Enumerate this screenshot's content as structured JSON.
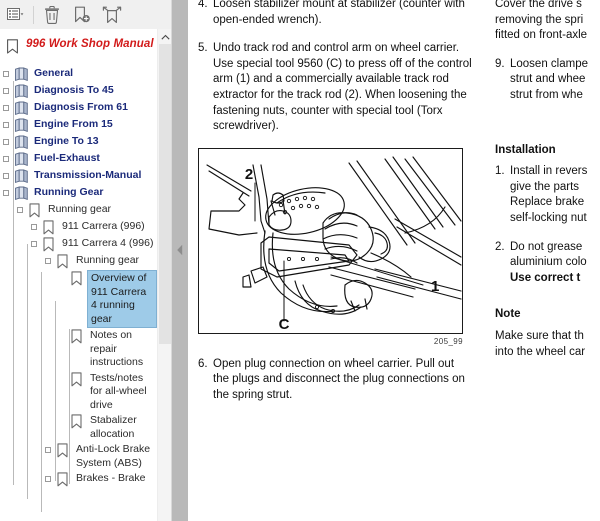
{
  "window": {
    "app_kind": "pdf-reader",
    "accent_red": "#d21b1b",
    "selection_blue": "#9ecbe8",
    "tree_text_blue": "#1b2a7a"
  },
  "bookmarks_toolbar": {
    "buttons": [
      {
        "name": "options-list-button",
        "icon": "list-options-icon",
        "label": "Options"
      },
      {
        "name": "delete-bookmark-button",
        "icon": "trash-icon",
        "label": "Delete"
      },
      {
        "name": "new-bookmark-button",
        "icon": "bookmark-plus-icon",
        "label": "New Bookmark"
      },
      {
        "name": "expand-bookmark-button",
        "icon": "bookmark-expand-icon",
        "label": "Expand Current Bookmark"
      }
    ]
  },
  "bookmarks": {
    "root_title": "996 Work Shop Manual",
    "root_icon": "bookmark-icon",
    "items": [
      {
        "label": "General",
        "level": 0,
        "icon": "book-icon",
        "expandable": true,
        "selected": false
      },
      {
        "label": "Diagnosis To 45",
        "level": 0,
        "icon": "book-icon",
        "expandable": true,
        "selected": false
      },
      {
        "label": "Diagnosis From 61",
        "level": 0,
        "icon": "book-icon",
        "expandable": true,
        "selected": false
      },
      {
        "label": "Engine From 15",
        "level": 0,
        "icon": "book-icon",
        "expandable": true,
        "selected": false
      },
      {
        "label": "Engine To 13",
        "level": 0,
        "icon": "book-icon",
        "expandable": true,
        "selected": false
      },
      {
        "label": "Fuel-Exhaust",
        "level": 0,
        "icon": "book-icon",
        "expandable": true,
        "selected": false
      },
      {
        "label": "Transmission-Manual",
        "level": 0,
        "icon": "book-icon",
        "expandable": true,
        "selected": false
      },
      {
        "label": "Running Gear",
        "level": 0,
        "icon": "book-icon",
        "expandable": true,
        "selected": false
      },
      {
        "label": "Running gear",
        "level": 1,
        "icon": "bookmark-icon",
        "expandable": true,
        "selected": false
      },
      {
        "label": "911 Carrera (996)",
        "level": 2,
        "icon": "bookmark-icon",
        "expandable": true,
        "selected": false
      },
      {
        "label": "911 Carrera 4 (996)",
        "level": 2,
        "icon": "bookmark-icon",
        "expandable": true,
        "selected": false
      },
      {
        "label": "Running gear",
        "level": 3,
        "icon": "bookmark-icon",
        "expandable": true,
        "selected": false
      },
      {
        "label": "Overview of 911 Carrera 4 running gear",
        "level": 4,
        "icon": "bookmark-icon",
        "expandable": false,
        "selected": true
      },
      {
        "label": "Notes on repair instructions",
        "level": 4,
        "icon": "bookmark-icon",
        "expandable": false,
        "selected": false
      },
      {
        "label": "Tests/notes for all-wheel drive",
        "level": 4,
        "icon": "bookmark-icon",
        "expandable": false,
        "selected": false
      },
      {
        "label": "Stabalizer allocation",
        "level": 4,
        "icon": "bookmark-icon",
        "expandable": false,
        "selected": false
      },
      {
        "label": "Anti-Lock Brake System (ABS)",
        "level": 3,
        "icon": "bookmark-icon",
        "expandable": true,
        "selected": false
      },
      {
        "label": "Brakes - Brake",
        "level": 3,
        "icon": "bookmark-icon",
        "expandable": true,
        "selected": false
      }
    ]
  },
  "splitter": {
    "collapse_icon": "chevron-left-icon"
  },
  "scrollbar": {
    "up_arrow_icon": "chevron-up-icon"
  },
  "document": {
    "left_column": {
      "steps": [
        {
          "num": "4.",
          "text": "Loosen stabilizer mount at stabilizer (counter with open-ended wrench)."
        },
        {
          "num": "5.",
          "text": "Undo track rod and control arm on wheel carrier. Use special tool 9560 (C) to press off of the control arm (1) and a commercially available track rod extractor for the track rod (2). When loosening the fastening nuts, counter with special tool (Torx screwdriver)."
        }
      ],
      "figure": {
        "name": "suspension-diagram",
        "caption": "205_99",
        "callouts": [
          "1",
          "2",
          "C"
        ],
        "alt": "Line drawing of front wheel carrier, control arm, track rod and drive shaft boot"
      },
      "steps_after": [
        {
          "num": "6.",
          "text": "Open plug connection on wheel carrier. Pull out the plugs and disconnect the plug connections on the spring strut."
        }
      ]
    },
    "right_column": {
      "intro_lines": [
        "Cover the drive s",
        "removing the spri",
        "fitted on front-axle"
      ],
      "step9": {
        "num": "9.",
        "lines": [
          "Loosen clampe",
          "strut and whee",
          "strut from whe"
        ]
      },
      "installation_heading": "Installation",
      "installation_steps": [
        {
          "num": "1.",
          "lines": [
            "Install in revers",
            "give the parts",
            "Replace brake",
            "self-locking nut"
          ],
          "bold_last": false
        },
        {
          "num": "2.",
          "lines": [
            "Do not grease",
            "aluminium colo"
          ],
          "bold_lines": [
            "Use correct t"
          ]
        }
      ],
      "note_heading": "Note",
      "note_lines": [
        "Make sure that th",
        "into the wheel car"
      ]
    }
  }
}
